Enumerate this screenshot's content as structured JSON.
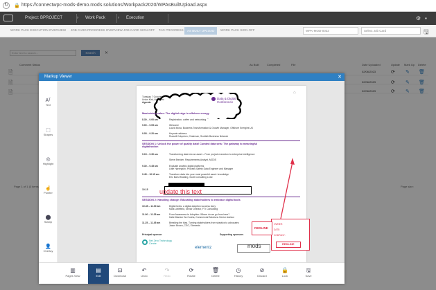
{
  "browser": {
    "url": "https://connectwpc-mods-demo.mods.solutions/Workpack2020/WPAsBuiltUpload.aspx"
  },
  "header": {
    "project": "Project: BPROJECT",
    "workpack": "Work Pack",
    "execution": "Execution"
  },
  "tabs": [
    {
      "label": "WORK PACK EXECUTION OVERVIEW"
    },
    {
      "label": "JOB CARD PROGRESS OVERVIEW"
    },
    {
      "label": "JOB CARD SIGN OFF"
    },
    {
      "label": "TAG PROGRESS"
    },
    {
      "label": "AS BUILT UPLOAD"
    },
    {
      "label": "WORK PACK SIGN OFF"
    }
  ],
  "workpack_select": "WPK-MOD-0022",
  "jobcard_select": "Select Job Card",
  "background": {
    "search_placeholder": "Enter text to search...",
    "search_button": "Search",
    "columns": [
      "Comment Status",
      "As Built",
      "Completed",
      "File",
      "Date Uploaded",
      "Update",
      "Mark Up",
      "Delete"
    ],
    "dates": [
      "02/06/2023",
      "02/06/2023",
      "02/06/2023"
    ],
    "pager": "Page 1 of 1 (3 items)",
    "pager_right": "Page size:"
  },
  "modal": {
    "title": "Markup Viewer",
    "left_tools": [
      "Text",
      "Shapes",
      "Highlight",
      "Pointer",
      "Stamp",
      "Overlay"
    ],
    "bottom_tools": [
      "Pages View",
      "Edit",
      "Download",
      "Undo",
      "Redo",
      "Rotate",
      "Delete",
      "History",
      "Discard",
      "Lock",
      "Save"
    ]
  },
  "doc": {
    "date": "Tuesday 7 October",
    "venue": "Union Kirk, Aberdeen",
    "agenda": "Agenda",
    "theme": "Maximising value: The digital edge in offshore energy",
    "logo_line1": "Data & Digital",
    "logo_line2": "Conference",
    "annotation": "update this text",
    "redline": "REDLINE",
    "stamp_owner": "OWNER:",
    "stamp_date": "DATE:",
    "stamp_company": "COMPANY:",
    "stamp_label": "REDLINE",
    "sponsor_principal": "Principal sponsor",
    "sponsor_supporting": "Supporting sponsors",
    "elementz": "elementz",
    "mods": "mods",
    "netzero": "Net Zero Technology Centre",
    "session1": "SESSION 1: Unlock the power of quality data! Curated data sets: The gateway to meaningful digitalisation",
    "session2": "SESSION 2: Handling change: Educating stakeholders to embrace digital tools",
    "times": [
      "8.30 – 9.00 am",
      "9.00 – 9.05 am",
      "9.05 – 9.20 am",
      "9.15 – 9.30 am",
      "9.30 – 9.45 am",
      "9.45 – 10.15 am",
      "10.15",
      "10.45 – 11.00 am",
      "11.00 – 11.25 am",
      "11.25 – 11.45 am"
    ],
    "items": [
      "Registration, coffee and networking",
      "Welcome",
      "Keynote address",
      "Transforming data into an asset – From project execution to enterprise intelligence",
      "Evaluate analytic digital platforms",
      "Transform data into your most powerful asset: knowledge",
      "Digital twins: a digital adoption success story",
      "From Awareness to Adoption: Where do we go from here?",
      "Breaking the bias. Turning stakeholders from skeptics to advocates"
    ],
    "speakers": [
      "Laura Mova, Business Transformation & Growth Manager, Offshore Energies UK",
      "Russell Colquhon, Chairman, Scottish Business Network",
      "Steve Brecker, Requirements Analyst, MODS",
      "Little Harrington, Process Safety Data Engineer and Manager",
      "Eric Bain-Reading, Scott Consulting Lead",
      "Mark Littlefield, Sector Director, FTI Consulting",
      "Katie Mardon Da Cunha, Commercial Solutions Senior Advisor",
      "Jason Brown, CEO, Elements"
    ]
  },
  "colors": {
    "accent": "#2f80c3",
    "header_bg": "#3c3c3c",
    "redline": "#e0304a",
    "purple": "#6a2c91"
  }
}
